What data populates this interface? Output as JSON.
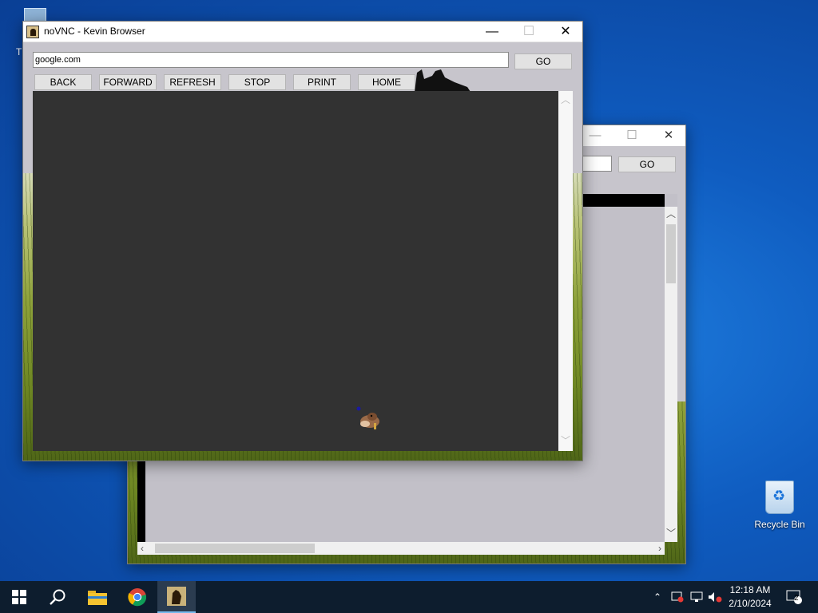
{
  "desktop": {
    "partial_icon_label": "Th",
    "recycle_bin_label": "Recycle Bin"
  },
  "front_window": {
    "title": "noVNC - Kevin Browser",
    "url_value": "google.com",
    "go_label": "GO",
    "nav_buttons": [
      "BACK",
      "FORWARD",
      "REFRESH",
      "STOP",
      "PRINT",
      "HOME"
    ],
    "controls": {
      "minimize": "—",
      "maximize": "☐",
      "close": "✕"
    }
  },
  "back_window": {
    "go_label": "GO",
    "controls": {
      "minimize": "—",
      "maximize": "☐",
      "close": "✕"
    }
  },
  "taskbar": {
    "time": "12:18 AM",
    "date": "2/10/2024",
    "notification_count": "2",
    "icons": [
      "windows-start-icon",
      "search-icon",
      "file-explorer-icon",
      "chrome-icon",
      "kevin-browser-icon"
    ]
  },
  "colors": {
    "desktop_blue": "#0f5cc0",
    "window_gray": "#c7c5cc",
    "viewport_dark": "#323232",
    "taskbar": "#0d1d2e"
  }
}
